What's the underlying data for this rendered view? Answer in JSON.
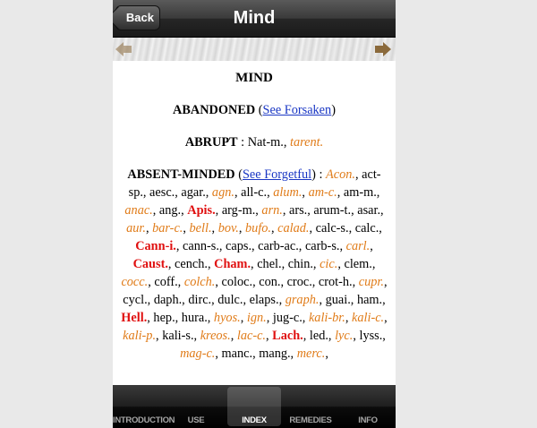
{
  "navbar": {
    "back_label": "Back",
    "title": "Mind"
  },
  "colors": {
    "orange": "#e07b18",
    "red": "#e01010",
    "link": "#1a37c4",
    "arrow": "#8b6a3c"
  },
  "content": {
    "heading": "MIND",
    "entries": [
      {
        "rubric": "ABANDONED",
        "segments": [
          {
            "t": "p",
            "v": " ("
          },
          {
            "t": "link",
            "v": "See Forsaken"
          },
          {
            "t": "p",
            "v": ")"
          }
        ]
      },
      {
        "rubric": "ABRUPT",
        "segments": [
          {
            "t": "p",
            "v": " : Nat-m., "
          },
          {
            "t": "o",
            "v": "tarent."
          }
        ]
      },
      {
        "rubric": "ABSENT-MINDED",
        "segments": [
          {
            "t": "p",
            "v": " ("
          },
          {
            "t": "link",
            "v": "See Forgetful"
          },
          {
            "t": "p",
            "v": ") : "
          },
          {
            "t": "o",
            "v": "Acon."
          },
          {
            "t": "p",
            "v": ", act-sp., aesc., agar., "
          },
          {
            "t": "o",
            "v": "agn."
          },
          {
            "t": "p",
            "v": ", all-c., "
          },
          {
            "t": "o",
            "v": "alum."
          },
          {
            "t": "p",
            "v": ", "
          },
          {
            "t": "o",
            "v": "am-c."
          },
          {
            "t": "p",
            "v": ", am-m., "
          },
          {
            "t": "o",
            "v": "anac."
          },
          {
            "t": "p",
            "v": ", ang., "
          },
          {
            "t": "b",
            "v": "Apis."
          },
          {
            "t": "p",
            "v": ", arg-m., "
          },
          {
            "t": "o",
            "v": "arn."
          },
          {
            "t": "p",
            "v": ", ars., arum-t., asar., "
          },
          {
            "t": "o",
            "v": "aur."
          },
          {
            "t": "p",
            "v": ", "
          },
          {
            "t": "o",
            "v": "bar-c."
          },
          {
            "t": "p",
            "v": ", "
          },
          {
            "t": "o",
            "v": "bell."
          },
          {
            "t": "p",
            "v": ", "
          },
          {
            "t": "o",
            "v": "bov."
          },
          {
            "t": "p",
            "v": ", "
          },
          {
            "t": "o",
            "v": "bufo."
          },
          {
            "t": "p",
            "v": ", "
          },
          {
            "t": "o",
            "v": "calad."
          },
          {
            "t": "p",
            "v": ", calc-s., calc., "
          },
          {
            "t": "b",
            "v": "Cann-i."
          },
          {
            "t": "p",
            "v": ", cann-s., caps., carb-ac., carb-s., "
          },
          {
            "t": "o",
            "v": "carl."
          },
          {
            "t": "p",
            "v": ", "
          },
          {
            "t": "b",
            "v": "Caust."
          },
          {
            "t": "p",
            "v": ", cench., "
          },
          {
            "t": "b",
            "v": "Cham."
          },
          {
            "t": "p",
            "v": ", chel., chin., "
          },
          {
            "t": "o",
            "v": "cic."
          },
          {
            "t": "p",
            "v": ", clem., "
          },
          {
            "t": "o",
            "v": "cocc."
          },
          {
            "t": "p",
            "v": ", coff., "
          },
          {
            "t": "o",
            "v": "colch."
          },
          {
            "t": "p",
            "v": ", coloc., con., croc., crot-h., "
          },
          {
            "t": "o",
            "v": "cupr."
          },
          {
            "t": "p",
            "v": ", cycl., daph., dirc., dulc., elaps., "
          },
          {
            "t": "o",
            "v": "graph."
          },
          {
            "t": "p",
            "v": ", guai., ham., "
          },
          {
            "t": "b",
            "v": "Hell."
          },
          {
            "t": "p",
            "v": ", hep., hura., "
          },
          {
            "t": "o",
            "v": "hyos."
          },
          {
            "t": "p",
            "v": ", "
          },
          {
            "t": "o",
            "v": "ign."
          },
          {
            "t": "p",
            "v": ", jug-c., "
          },
          {
            "t": "o",
            "v": "kali-br."
          },
          {
            "t": "p",
            "v": ", "
          },
          {
            "t": "o",
            "v": "kali-c."
          },
          {
            "t": "p",
            "v": ", "
          },
          {
            "t": "o",
            "v": "kali-p."
          },
          {
            "t": "p",
            "v": ", kali-s., "
          },
          {
            "t": "o",
            "v": "kreos."
          },
          {
            "t": "p",
            "v": ", "
          },
          {
            "t": "o",
            "v": "lac-c."
          },
          {
            "t": "p",
            "v": ", "
          },
          {
            "t": "b",
            "v": "Lach."
          },
          {
            "t": "p",
            "v": ", led., "
          },
          {
            "t": "o",
            "v": "lyc."
          },
          {
            "t": "p",
            "v": ", lyss., "
          },
          {
            "t": "o",
            "v": "mag-c."
          },
          {
            "t": "p",
            "v": ", manc., mang., "
          },
          {
            "t": "o",
            "v": "merc."
          },
          {
            "t": "p",
            "v": ","
          }
        ]
      }
    ]
  },
  "tabs": [
    {
      "label": "INTRODUCTION",
      "active": false
    },
    {
      "label": "USE",
      "active": false
    },
    {
      "label": "INDEX",
      "active": true
    },
    {
      "label": "REMEDIES",
      "active": false
    },
    {
      "label": "INFO",
      "active": false
    }
  ]
}
